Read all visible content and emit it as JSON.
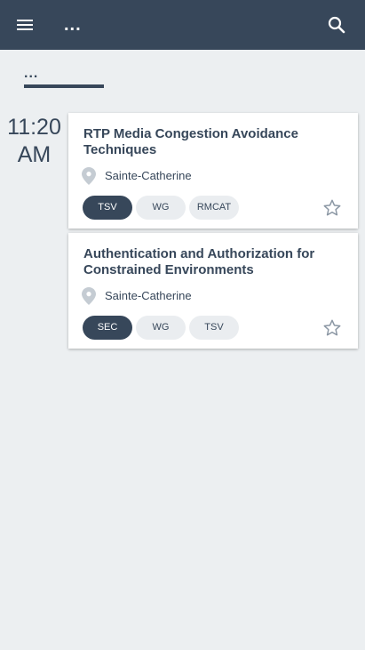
{
  "app_bar": {
    "title": "...",
    "menu_icon": "menu-icon",
    "search_icon": "search-icon",
    "bg_color": "#37475a"
  },
  "tabs": [
    {
      "label": "..."
    }
  ],
  "schedule": {
    "time_hour": "11:20",
    "time_period": "AM"
  },
  "sessions": [
    {
      "title": "RTP Media Congestion Avoidance Techniques",
      "location": "Sainte-Catherine",
      "tags": [
        {
          "label": "TSV",
          "style": "filled"
        },
        {
          "label": "WG",
          "style": "plain"
        },
        {
          "label": "RMCAT",
          "style": "plain"
        }
      ],
      "favorite": false
    },
    {
      "title": "Authentication and Authorization for Constrained Environments",
      "location": "Sainte-Catherine",
      "tags": [
        {
          "label": "SEC",
          "style": "filled"
        },
        {
          "label": "WG",
          "style": "plain"
        },
        {
          "label": "TSV",
          "style": "plain"
        }
      ],
      "favorite": false
    }
  ]
}
